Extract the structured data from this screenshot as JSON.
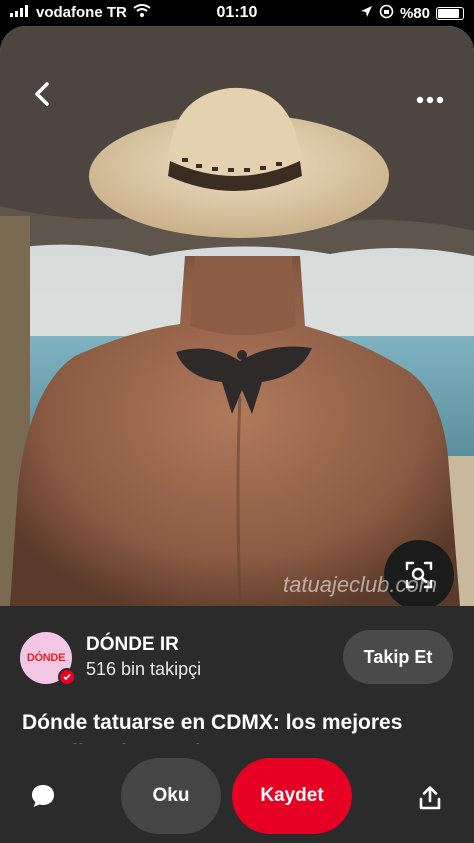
{
  "status_bar": {
    "carrier": "vodafone TR",
    "time": "01:10",
    "battery": "%80",
    "icons": [
      "signal-icon",
      "wifi-icon",
      "location-icon",
      "orientation-lock-icon",
      "battery-icon"
    ]
  },
  "pin": {
    "watermark": "tatuajeclub.com",
    "icons": [
      "back-icon",
      "more-icon",
      "visual-search-icon"
    ]
  },
  "profile": {
    "avatar_text": "DÓNDE",
    "name": "DÓNDE IR",
    "followers": "516 bin takipçi",
    "follow_label": "Takip Et"
  },
  "title": "Dónde tatuarse en CDMX: los mejores estudios de tatuajes",
  "actions": {
    "read_label": "Oku",
    "save_label": "Kaydet",
    "icons": [
      "comment-icon",
      "share-icon"
    ]
  },
  "colors": {
    "accent": "#e60023",
    "panel": "#2b2b2b",
    "button_secondary": "#4a4a4a"
  }
}
